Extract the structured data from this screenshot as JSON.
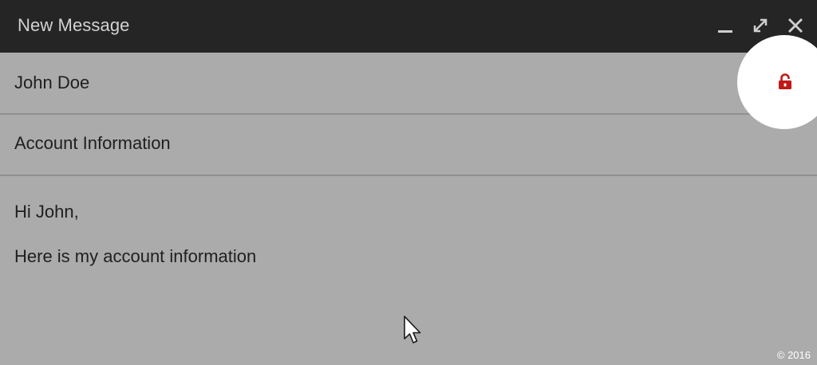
{
  "window": {
    "title": "New Message",
    "controls": [
      {
        "name": "minimize",
        "icon": "minimize-icon"
      },
      {
        "name": "expand",
        "icon": "expand-icon"
      },
      {
        "name": "close",
        "icon": "close-icon"
      }
    ]
  },
  "compose": {
    "to": "John Doe",
    "subject": "Account Information",
    "body_lines": [
      "Hi John,",
      "Here is my account information"
    ]
  },
  "encryption": {
    "icon": "unlocked-padlock-icon",
    "color": "#c01a17"
  },
  "overlay": {
    "copyright": "© 2016"
  },
  "colors": {
    "titlebar": "#252525",
    "background": "#ababab",
    "highlight": "#ffffff"
  }
}
